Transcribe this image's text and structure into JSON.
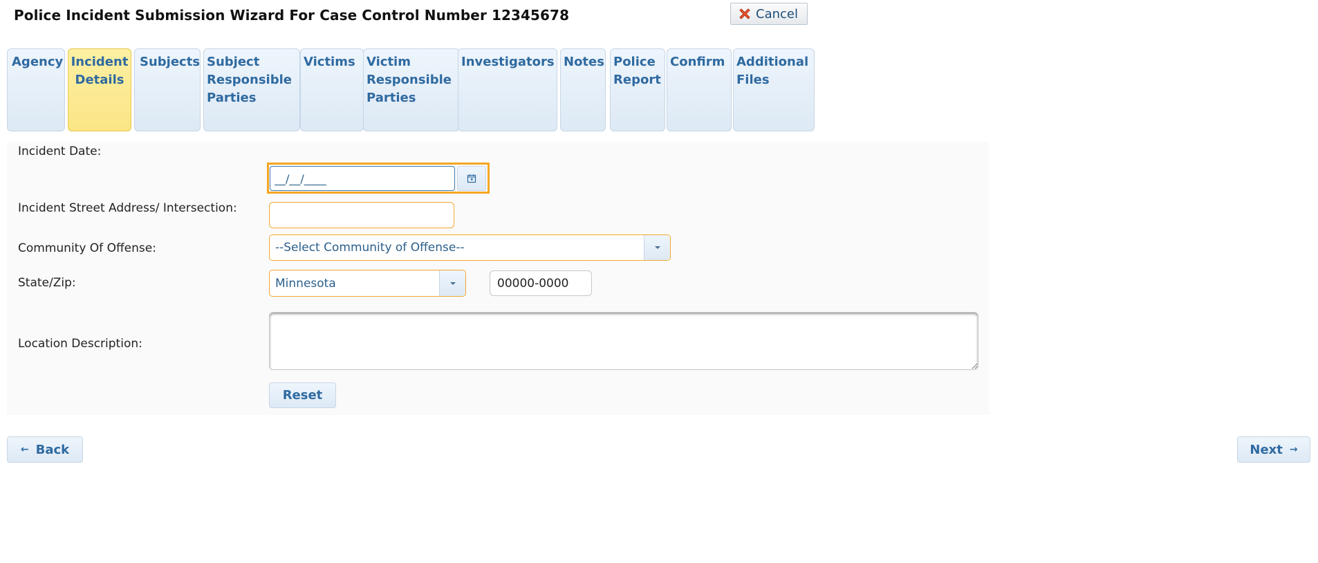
{
  "header": {
    "title": "Police Incident Submission Wizard For Case Control Number 12345678",
    "cancel_label": "Cancel"
  },
  "tabs": [
    {
      "label": "Agency"
    },
    {
      "label": "Incident\nDetails",
      "active": true
    },
    {
      "label": "Subjects"
    },
    {
      "label": "Subject\nResponsible\nParties"
    },
    {
      "label": "Victims"
    },
    {
      "label": "Victim\nResponsible\nParties"
    },
    {
      "label": "Investigators"
    },
    {
      "label": "Notes"
    },
    {
      "label": "Police\nReport"
    },
    {
      "label": "Confirm"
    },
    {
      "label": "Additional\nFiles"
    }
  ],
  "form": {
    "incident_date_label": "Incident Date:",
    "incident_date_value": "__/__/____",
    "address_label": "Incident Street Address/ Intersection:",
    "address_value": "",
    "community_label": "Community Of Offense:",
    "community_value": "--Select Community of Offense--",
    "state_zip_label": "State/Zip:",
    "state_value": "Minnesota",
    "zip_value": "00000-0000",
    "location_label": "Location Description:",
    "location_value": "",
    "reset_label": "Reset"
  },
  "footer": {
    "back_label": "Back",
    "next_label": "Next"
  },
  "colors": {
    "accent": "#2f6aa0",
    "active_tab": "#fbe585",
    "focus_border": "#f5a623"
  }
}
